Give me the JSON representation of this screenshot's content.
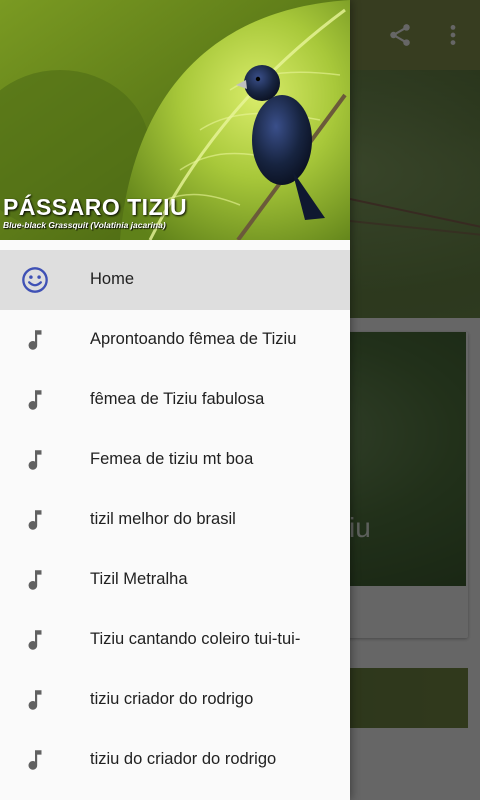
{
  "app_bar": {
    "title": "..."
  },
  "card": {
    "title_fragment": "ziu"
  },
  "drawer": {
    "header": {
      "title": "PÁSSARO TIZIU",
      "subtitle": "Blue-black Grassquit (Volatinia jacarina)"
    },
    "items": [
      {
        "label": "Home",
        "icon": "smiley-face-icon",
        "selected": true
      },
      {
        "label": "Apronto­ando fêmea de Tiziu",
        "icon": "music-note-icon",
        "selected": false
      },
      {
        "label": "fêmea de Tiziu fabulosa",
        "icon": "music-note-icon",
        "selected": false
      },
      {
        "label": "Femea de tiziu mt boa",
        "icon": "music-note-icon",
        "selected": false
      },
      {
        "label": "tizil melhor do brasil",
        "icon": "music-note-icon",
        "selected": false
      },
      {
        "label": "Tizil Metralha",
        "icon": "music-note-icon",
        "selected": false
      },
      {
        "label": "Tiziu cantando coleiro tui-tui-",
        "icon": "music-note-icon",
        "selected": false
      },
      {
        "label": "tiziu criador do rodrigo",
        "icon": "music-note-icon",
        "selected": false
      },
      {
        "label": "tiziu do criador do rodrigo",
        "icon": "music-note-icon",
        "selected": false
      }
    ]
  },
  "colors": {
    "app_bar": "#8a9a52",
    "selected_item_bg": "#dedede",
    "home_icon": "#3f51b5",
    "note_icon": "#616161"
  }
}
